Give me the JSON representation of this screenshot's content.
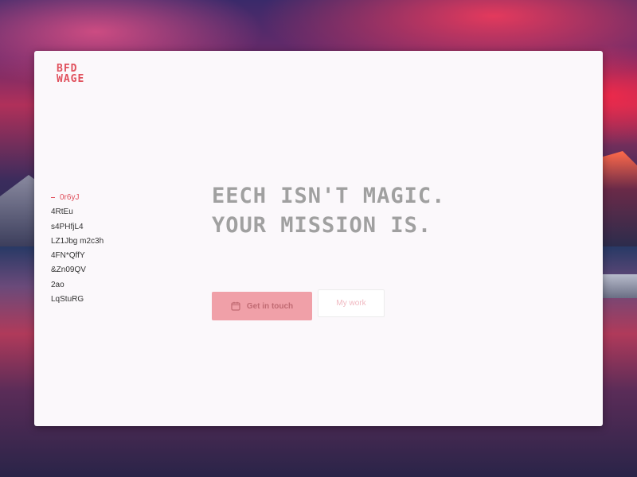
{
  "logo": {
    "line1": "BFD",
    "line2": "WAGE"
  },
  "nav": {
    "items": [
      {
        "label": "0r6yJ",
        "active": true
      },
      {
        "label": "4RtEu"
      },
      {
        "label": "s4PHfjL4"
      },
      {
        "label": "LZ1Jbg m2c3h"
      },
      {
        "label": "4FN*QffY"
      },
      {
        "label": "&Zn09QV"
      },
      {
        "label": "2ao"
      },
      {
        "label": "LqStuRG"
      }
    ]
  },
  "hero": {
    "line1": "EECH ISN'T MAGIC.",
    "line2": "YOUR MISSION IS."
  },
  "buttons": {
    "primary_label": "Get in touch",
    "primary_icon": "calendar-icon",
    "secondary_label": "My work"
  },
  "colors": {
    "accent": "#e0505c",
    "primary_button": "#f0a0a8",
    "hero_text": "#a0a0a0",
    "window_bg": "#fbf8fb"
  }
}
